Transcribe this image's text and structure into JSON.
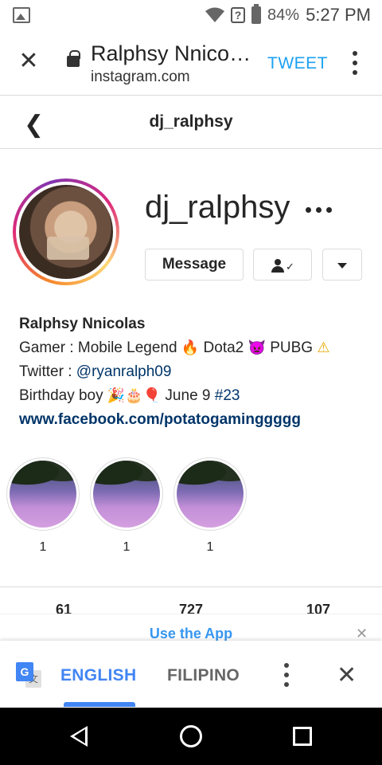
{
  "status_bar": {
    "battery": "84%",
    "time": "5:27 PM"
  },
  "browser": {
    "title": "Ralphsy Nnico…",
    "domain": "instagram.com",
    "tweet_label": "TWEET"
  },
  "ig_header": {
    "username": "dj_ralphsy"
  },
  "profile": {
    "username": "dj_ralphsy",
    "message_label": "Message",
    "following_check": "✓"
  },
  "bio": {
    "full_name": "Ralphsy Nnicolas",
    "line1_text": "Gamer : Mobile Legend ",
    "line1_mid": " Dota2 ",
    "line1_end": " PUBG ",
    "emoji_fire": "🔥",
    "emoji_devil": "👿",
    "emoji_warning": "⚠",
    "line2_prefix": "Twitter : ",
    "twitter_handle": "@ryanralph09",
    "line3_prefix": "Birthday boy ",
    "emoji_party": "🎉🎂🎈",
    "line3_date": " June 9 ",
    "hashtag": "#23",
    "website": "www.facebook.com/potatogaminggggg"
  },
  "highlights": [
    {
      "label": "1"
    },
    {
      "label": "1"
    },
    {
      "label": "1"
    }
  ],
  "stats": {
    "posts": "61",
    "followers": "727",
    "following": "107"
  },
  "app_banner": {
    "text": "Use the App",
    "close": "✕"
  },
  "translate_bar": {
    "lang_source": "ENGLISH",
    "lang_target": "FILIPINO",
    "close": "✕",
    "icon_letter_g": "G",
    "icon_letter_t": "文"
  },
  "colors": {
    "accent_blue": "#3897f0",
    "translate_blue": "#4285f4",
    "twitter_blue": "#1da1f2",
    "link_dark_blue": "#003569"
  }
}
